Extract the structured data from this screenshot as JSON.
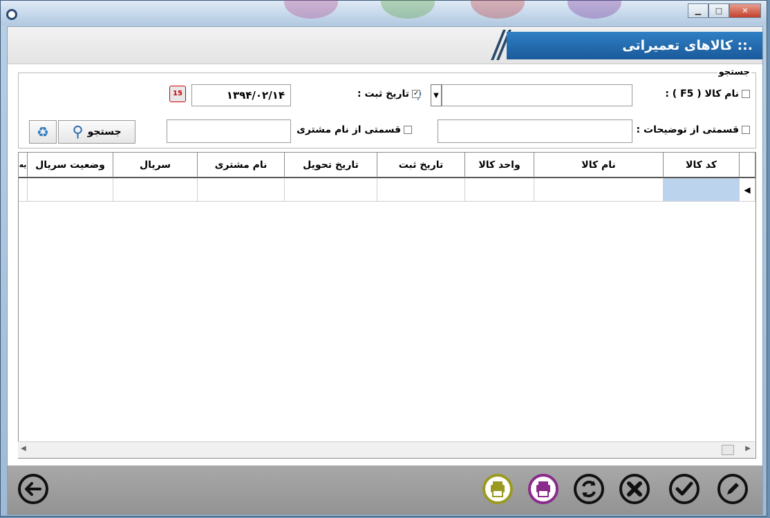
{
  "window": {
    "controls": [
      "minimize",
      "maximize",
      "close"
    ]
  },
  "header": {
    "title": ".:: کالاهای تعمیراتی"
  },
  "search": {
    "legend": "جستجو",
    "item_name_label": "نام کالا ( F5 ) :",
    "item_name_checked": false,
    "item_name_value": "",
    "reg_date_label": "تاریخ ثبت :",
    "reg_date_checked": true,
    "reg_date_value": "۱۳۹۴/۰۲/۱۴",
    "desc_label": "قسمتی از توضیحات :",
    "desc_checked": false,
    "desc_value": "",
    "customer_label": "قسمتی از نام مشتری",
    "customer_checked": false,
    "customer_value": "",
    "search_button": "جستجو",
    "calendar_icon_day": "15"
  },
  "grid": {
    "columns": [
      "کد کالا",
      "نام کالا",
      "واحد کالا",
      "تاریخ ثبت",
      "تاریخ تحویل",
      "نام مشتری",
      "سریال",
      "وضعیت سریال",
      "یه"
    ],
    "rows": [
      [
        "",
        "",
        "",
        "",
        "",
        "",
        "",
        "",
        ""
      ]
    ]
  },
  "toolbar": {
    "buttons": [
      "edit-icon",
      "confirm-icon",
      "cancel-icon",
      "refresh-icon",
      "print-icon",
      "print-icon",
      "back-icon"
    ],
    "colors": {
      "print_purple": "#8a2a8a",
      "print_olive": "#9a9a20",
      "dark": "#111111"
    }
  }
}
